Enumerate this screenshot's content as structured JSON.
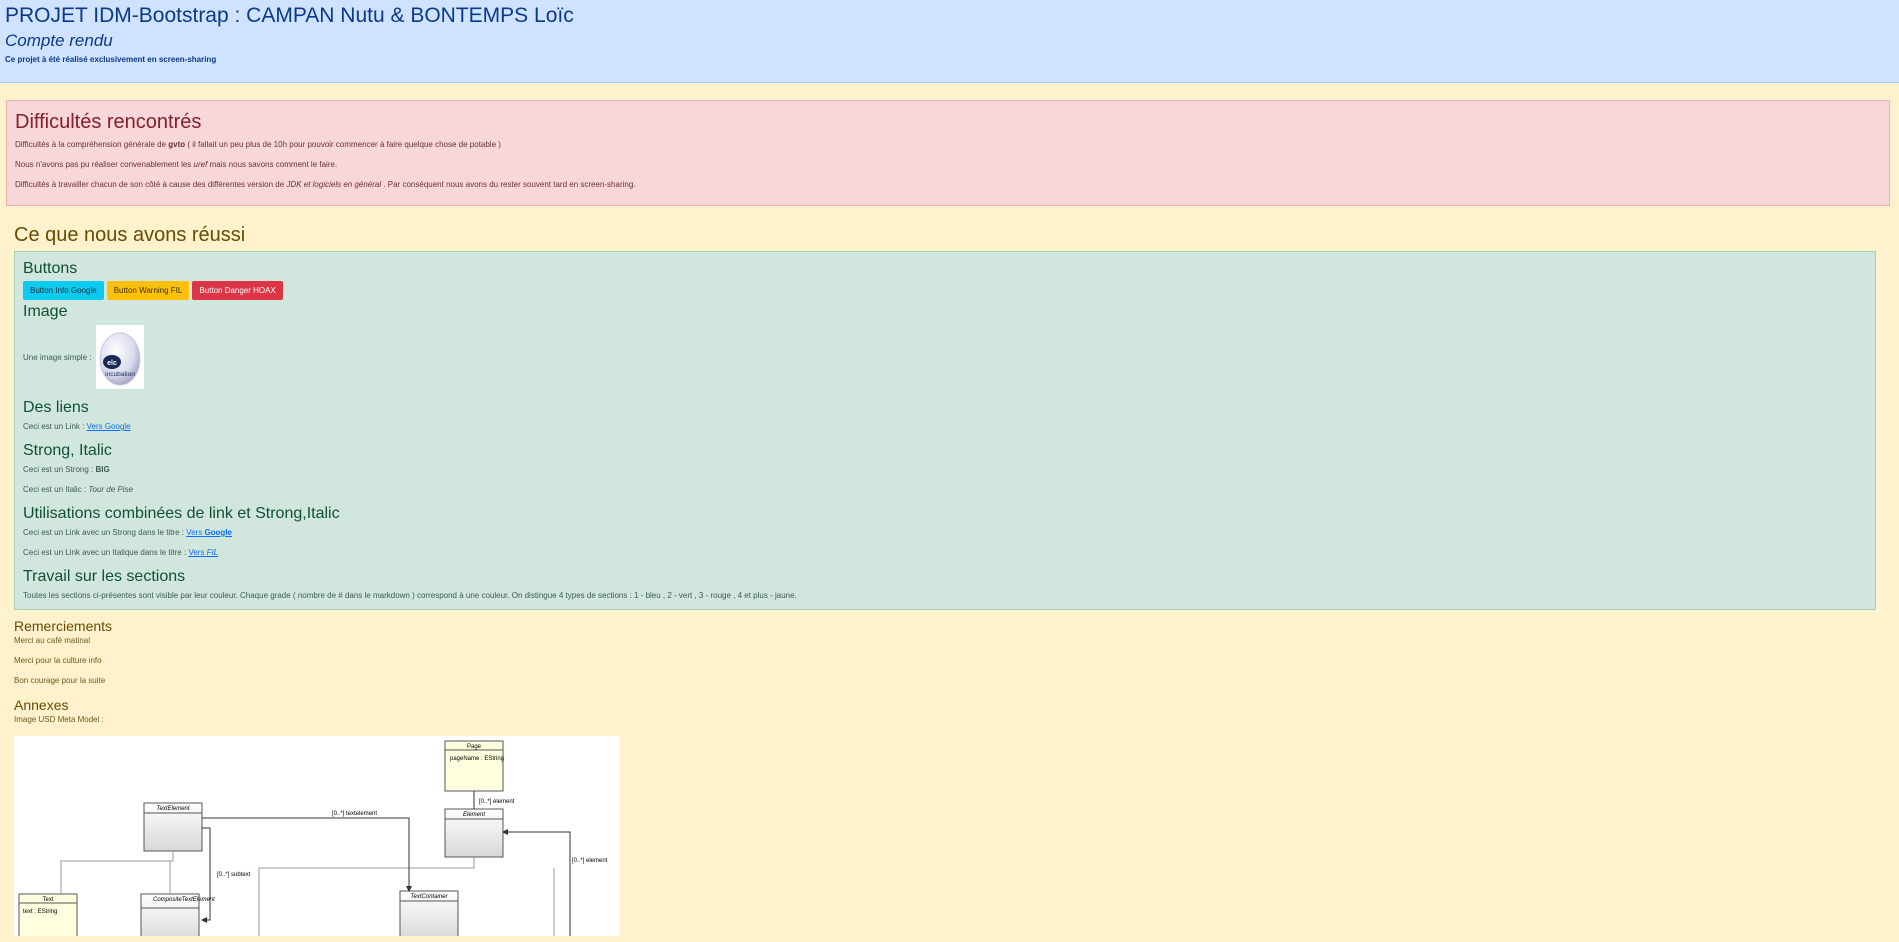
{
  "header": {
    "title": "PROJET IDM-Bootstrap : CAMPAN Nutu & BONTEMPS Loïc",
    "subtitle": "Compte rendu",
    "note": "Ce projet à été réalisé exclusivement en screen-sharing"
  },
  "difficulties": {
    "title": "Difficultés rencontrés",
    "line1_pre": "Difficultés à la compréhension générale de ",
    "line1_strong": "gvto",
    "line1_post": " ( il fallait un peu plus de 10h pour pouvoir commencer à faire quelque chose de potable )",
    "line2_pre": "Nous n'avons pas pu réaliser convenablement les ",
    "line2_em": "uref",
    "line2_post": " mais nous savons comment le faire.",
    "line3_pre": "Difficultés à travailler chacun de son côté à cause des différentes version de ",
    "line3_em": "JDK et logiciels en général",
    "line3_post": " . Par conséquent nous avons du rester souvent tard en screen-sharing."
  },
  "success": {
    "title": "Ce que nous avons réussi",
    "buttons": {
      "title": "Buttons",
      "info": "Button Info Google",
      "warning": "Button Warning FIL",
      "danger": "Button Danger HOAX"
    },
    "image": {
      "title": "Image",
      "label": "Une image simple :"
    },
    "links": {
      "title": "Des liens",
      "label": "Ceci est un Link : ",
      "link_text": "Vers Google"
    },
    "strong_italic": {
      "title": "Strong, Italic",
      "strong_label": "Ceci est un Strong : ",
      "strong_value": "BIG",
      "italic_label": "Ceci est un Italic : ",
      "italic_value": "Tour de Pise"
    },
    "combined": {
      "title": "Utilisations combinées de link et Strong,Italic",
      "line1_label": "Ceci est un Link avec un Strong dans le titre : ",
      "line1_link_pre": "Vers ",
      "line1_link_strong": "Google",
      "line2_label": "Ceci est un Link avec un Italique dans le titre : ",
      "line2_link_pre": "Vers ",
      "line2_link_em": "FIL"
    },
    "sections": {
      "title": "Travail sur les sections",
      "text": "Toutes les sections ci-présentes sont visible par leur couleur. Chaque grade ( nombre de # dans le markdown ) correspond à une couleur. On distingue 4 types de sections : 1 - bleu , 2 - vert , 3 - rouge , 4 et plus - jaune."
    }
  },
  "thanks": {
    "title": "Remerciements",
    "items": [
      "Merci au café matinal",
      "Merci pour la culture info",
      "Bon courage pour la suite"
    ]
  },
  "annexes": {
    "title": "Annexes",
    "label": "Image USD Meta Model :",
    "diagram": {
      "page": "Page",
      "page_attr": "pageName : EString",
      "element": "Element",
      "text_element": "TextElement",
      "text": "Text",
      "text_attr": "text : EString",
      "composite": "CompositeTextElement",
      "container": "TextContainer",
      "rel_element": "[0..*] element",
      "rel_textelement": "[0..*] textelement",
      "rel_subtext": "[0..*] subtext",
      "rel_element2": "[0..*] element"
    }
  },
  "egg_text": "incubation"
}
